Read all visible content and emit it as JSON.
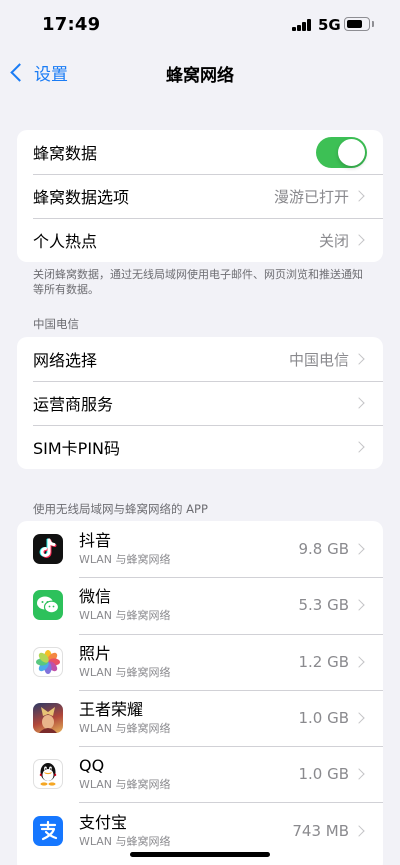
{
  "status_bar": {
    "time": "17:49",
    "network": "5G"
  },
  "nav": {
    "back_label": "设置",
    "title": "蜂窝网络"
  },
  "group1": {
    "cellular_data_label": "蜂窝数据",
    "cellular_data_on": true,
    "options_label": "蜂窝数据选项",
    "options_value": "漫游已打开",
    "hotspot_label": "个人热点",
    "hotspot_value": "关闭"
  },
  "footnote": "关闭蜂窝数据，通过无线局域网使用电子邮件、网页浏览和推送通知等所有数据。",
  "carrier_section": {
    "header": "中国电信",
    "network_select_label": "网络选择",
    "network_select_value": "中国电信",
    "carrier_services_label": "运营商服务",
    "sim_pin_label": "SIM卡PIN码"
  },
  "apps_section": {
    "header": "使用无线局域网与蜂窝网络的 APP",
    "apps": [
      {
        "name": "抖音",
        "sub": "WLAN 与蜂窝网络",
        "size": "9.8 GB",
        "icon": "douyin-icon"
      },
      {
        "name": "微信",
        "sub": "WLAN 与蜂窝网络",
        "size": "5.3 GB",
        "icon": "wechat-icon"
      },
      {
        "name": "照片",
        "sub": "WLAN 与蜂窝网络",
        "size": "1.2 GB",
        "icon": "photos-icon"
      },
      {
        "name": "王者荣耀",
        "sub": "WLAN 与蜂窝网络",
        "size": "1.0 GB",
        "icon": "honor-of-kings-icon"
      },
      {
        "name": "QQ",
        "sub": "WLAN 与蜂窝网络",
        "size": "1.0 GB",
        "icon": "qq-icon"
      },
      {
        "name": "支付宝",
        "sub": "WLAN 与蜂窝网络",
        "size": "743 MB",
        "icon": "alipay-icon"
      }
    ]
  },
  "colors": {
    "accent": "#1a7cf5",
    "toggle_on": "#3dc055",
    "background": "#f2f2f7"
  }
}
